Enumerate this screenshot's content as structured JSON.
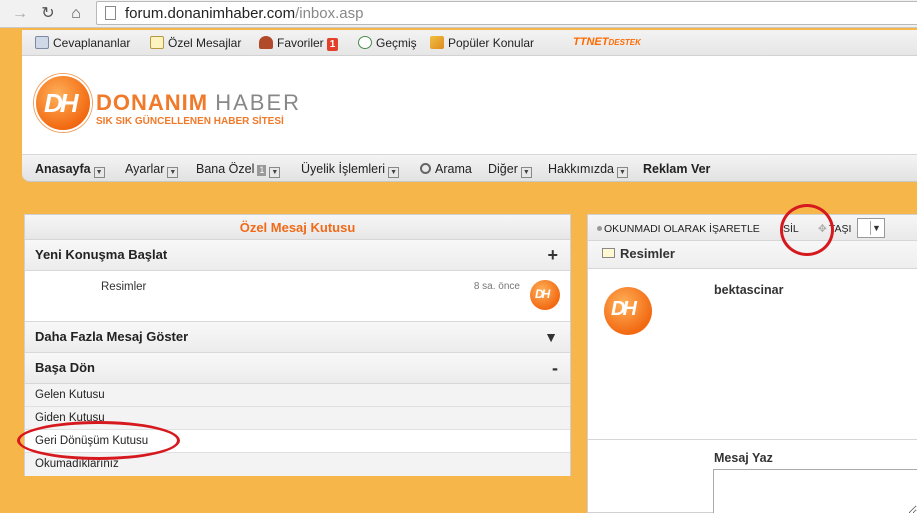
{
  "browser": {
    "url_host": "forum.donanimhaber.com",
    "url_path": "/inbox.asp"
  },
  "bookmarks": {
    "items": [
      {
        "label": "Cevaplananlar",
        "icon": "reply-list-icon"
      },
      {
        "label": "Özel Mesajlar",
        "icon": "envelope-icon"
      },
      {
        "label": "Favoriler",
        "icon": "heart-icon",
        "badge": "1"
      },
      {
        "label": "Geçmiş",
        "icon": "history-clock-icon"
      },
      {
        "label": "Popüler Konular",
        "icon": "chart-icon"
      }
    ],
    "ttnet": "TTNET",
    "ttnet_sub": "DESTEK"
  },
  "logo": {
    "mark": "DH",
    "name_a": "DONANIM",
    "name_b": "HABER",
    "tagline": "SIK SIK GÜNCELLENEN HABER SİTESİ"
  },
  "mainnav": {
    "items": [
      {
        "label": "Anasayfa"
      },
      {
        "label": "Ayarlar"
      },
      {
        "label": "Bana Özel",
        "count": "1"
      },
      {
        "label": "Üyelik İşlemleri"
      },
      {
        "label": "Arama"
      },
      {
        "label": "Diğer"
      },
      {
        "label": "Hakkımızda"
      },
      {
        "label": "Reklam Ver"
      }
    ]
  },
  "inbox": {
    "title": "Özel Mesaj Kutusu",
    "new_conversation": "Yeni Konuşma Başlat",
    "new_symbol": "+",
    "message": {
      "subject": "Resimler",
      "time": "8 sa. önce",
      "avatar": "DH"
    },
    "more": "Daha Fazla Mesaj Göster",
    "more_symbol": "▼",
    "back_top": "Başa Dön",
    "back_symbol": "-",
    "folders": [
      "Gelen Kutusu",
      "Giden Kutusu",
      "Geri Dönüşüm Kutusu",
      "Okumadıklarınız"
    ]
  },
  "reader": {
    "tool_unread": "OKUNMADI OLARAK İŞARETLE",
    "tool_delete": "SİL",
    "tool_move": "TAŞI",
    "subject": "Resimler",
    "sender": "bektascinar",
    "avatar": "DH",
    "write_label": "Mesaj Yaz"
  },
  "colors": {
    "accent": "#f06a18",
    "background": "#f7b64a",
    "annotation": "#d6191e"
  }
}
